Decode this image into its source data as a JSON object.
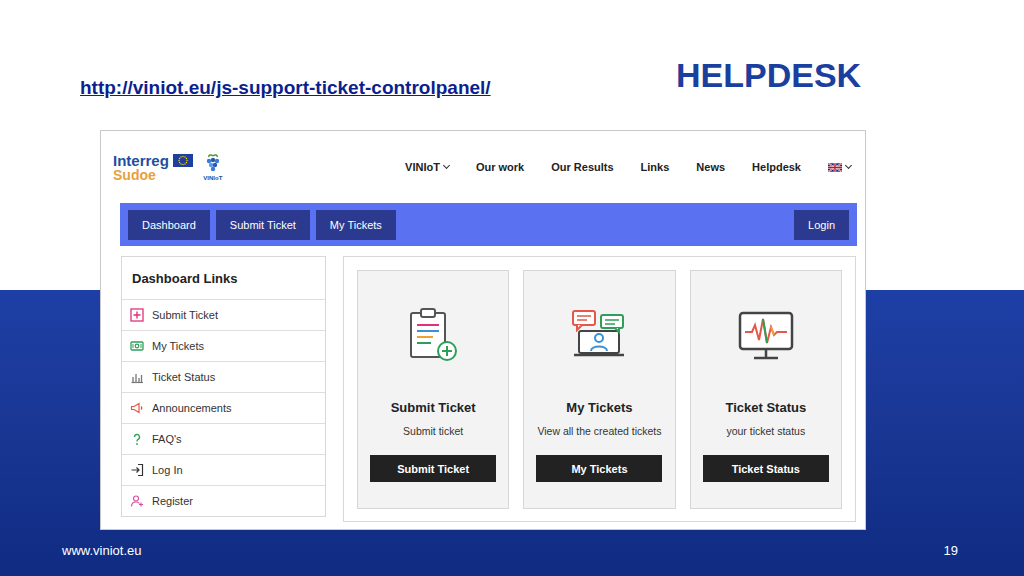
{
  "slide": {
    "link": "http://viniot.eu/js-support-ticket-controlpanel/",
    "title": "HELPDESK",
    "footer": "www.viniot.eu",
    "page_number": "19"
  },
  "site": {
    "logo": {
      "brand": "Interreg",
      "program": "Sudoe",
      "project": "VINIoT"
    },
    "nav": [
      {
        "label": "VINIoT",
        "dropdown": true
      },
      {
        "label": "Our work",
        "dropdown": false
      },
      {
        "label": "Our Results",
        "dropdown": false
      },
      {
        "label": "Links",
        "dropdown": false
      },
      {
        "label": "News",
        "dropdown": false
      },
      {
        "label": "Helpdesk",
        "dropdown": false
      }
    ],
    "language": {
      "dropdown": true
    }
  },
  "toolbar": {
    "buttons": [
      "Dashboard",
      "Submit Ticket",
      "My Tickets"
    ],
    "login": "Login"
  },
  "sidebar": {
    "title": "Dashboard Links",
    "items": [
      "Submit Ticket",
      "My Tickets",
      "Ticket Status",
      "Announcements",
      "FAQ's",
      "Log In",
      "Register"
    ]
  },
  "cards": [
    {
      "title": "Submit Ticket",
      "description": "Submit ticket",
      "button": "Submit Ticket"
    },
    {
      "title": "My Tickets",
      "description": "View all the created tickets",
      "button": "My Tickets"
    },
    {
      "title": "Ticket Status",
      "description": "your ticket status",
      "button": "Ticket Status"
    }
  ]
}
